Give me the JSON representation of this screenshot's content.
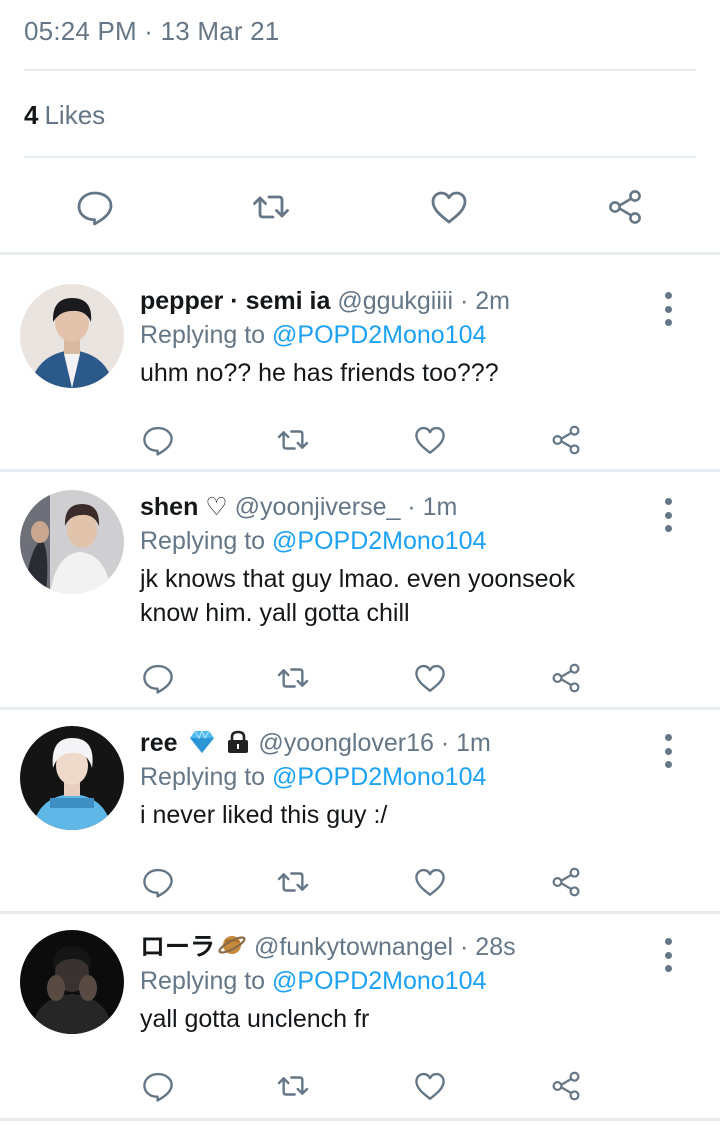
{
  "tweet": {
    "timestamp": "05:24 PM · 13 Mar 21",
    "likes_count": "4",
    "likes_label": "Likes",
    "actions": [
      "reply-icon",
      "retweet-icon",
      "like-icon",
      "share-icon"
    ]
  },
  "colors": {
    "muted": "#657786",
    "link": "#1da1f2",
    "divider": "#e6ecf0",
    "text": "#14171a"
  },
  "replies": [
    {
      "name": "pepper · semi ia",
      "badges": "",
      "handle": "@ggukgiiii",
      "time": "· 2m",
      "replying_label": "Replying to",
      "replying_to": "@POPD2Mono104",
      "text_lines": [
        "uhm no?? he has friends too???"
      ]
    },
    {
      "name": "shen ♡",
      "badges": "",
      "handle": "@yoonjiverse_",
      "time": "· 1m",
      "replying_label": "Replying to",
      "replying_to": "@POPD2Mono104",
      "text_lines": [
        "jk knows that guy lmao. even yoonseok",
        "know him. yall gotta chill"
      ]
    },
    {
      "name": "ree",
      "badges": "diamond-icon lock-icon",
      "handle": "@yoonglover16",
      "time": "· 1m",
      "replying_label": "Replying to",
      "replying_to": "@POPD2Mono104",
      "text_lines": [
        "i never liked this guy :/"
      ]
    },
    {
      "name": "ローラ",
      "badges": "planet-icon",
      "handle": "@funkytownangel",
      "time": "· 28s",
      "replying_label": "Replying to",
      "replying_to": "@POPD2Mono104",
      "text_lines": [
        "yall gotta unclench fr"
      ]
    }
  ]
}
